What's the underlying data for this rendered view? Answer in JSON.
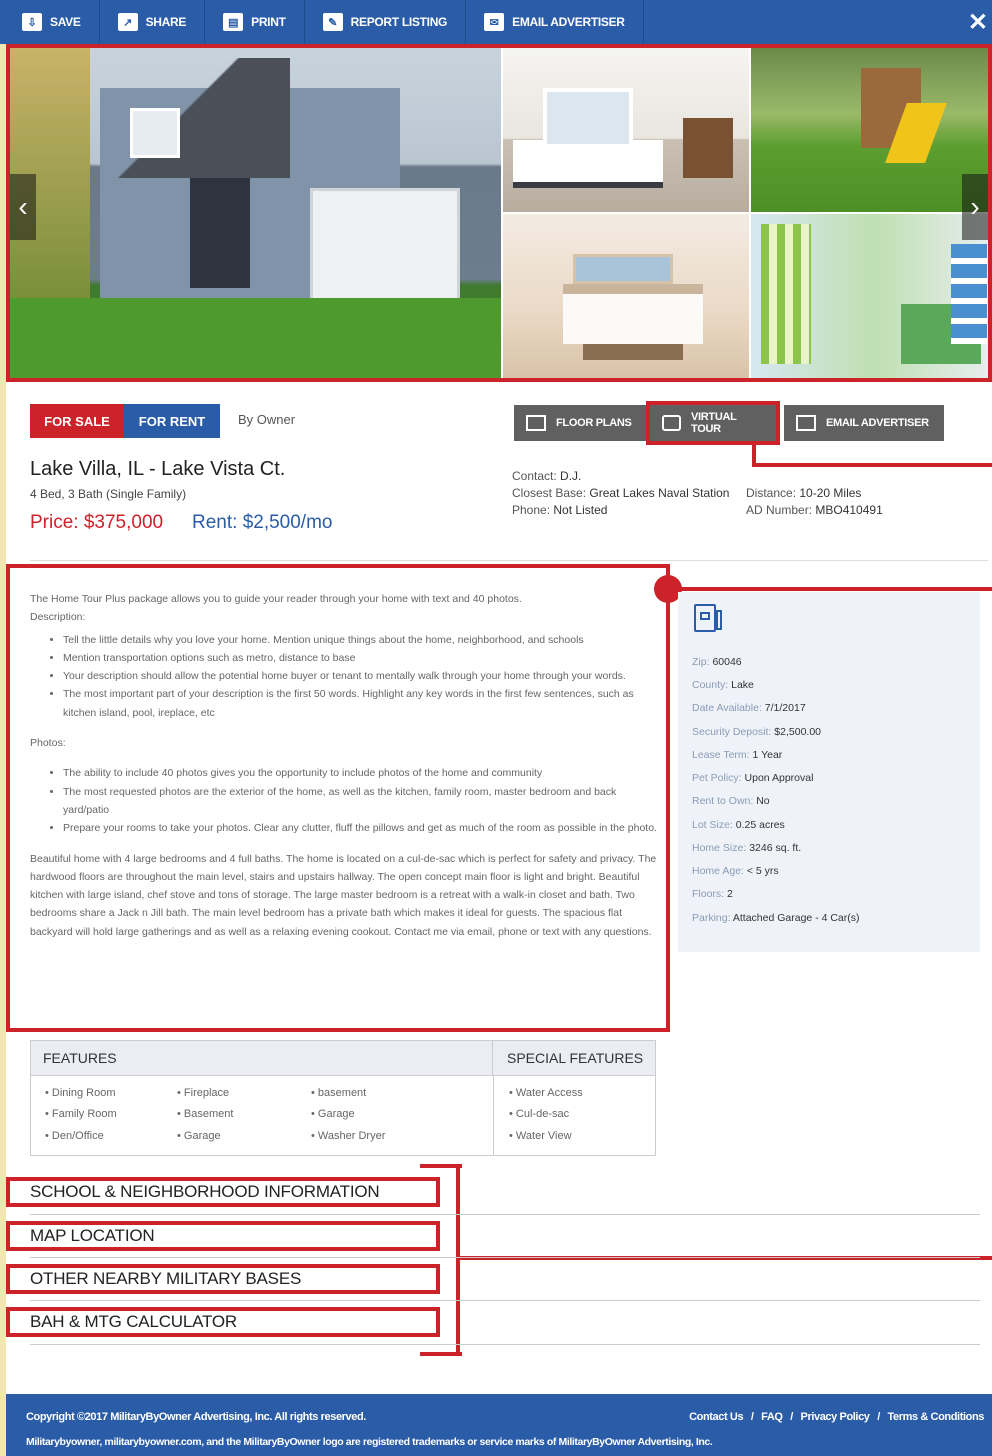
{
  "toolbar": {
    "items": [
      {
        "label": "SAVE",
        "icon": "download-icon"
      },
      {
        "label": "SHARE",
        "icon": "share-icon"
      },
      {
        "label": "PRINT",
        "icon": "print-icon"
      },
      {
        "label": "REPORT LISTING",
        "icon": "report-icon"
      },
      {
        "label": "EMAIL ADVERTISER",
        "icon": "megaphone-icon"
      }
    ],
    "close": "✕"
  },
  "gallery": {
    "prev": "‹",
    "next": "›"
  },
  "listing": {
    "for_sale": "FOR SALE",
    "for_rent": "FOR RENT",
    "by_owner": "By Owner",
    "title": "Lake Villa, IL - Lake Vista Ct.",
    "subtitle": "4 Bed, 3 Bath (Single Family)",
    "price": "Price: $375,000",
    "rent": "Rent: $2,500/mo",
    "buttons": {
      "floor_plans": "FLOOR PLANS",
      "virtual_tour": "VIRTUAL TOUR",
      "email_advertiser": "EMAIL ADVERTISER"
    },
    "contact_label": "Contact:",
    "contact_value": "D.J.",
    "base_label": "Closest Base:",
    "base_value": "Great Lakes Naval Station",
    "distance_label": "Distance:",
    "distance_value": "10-20 Miles",
    "phone_label": "Phone:",
    "phone_value": "Not Listed",
    "ad_label": "AD Number:",
    "ad_value": "MBO410491"
  },
  "description": {
    "intro": "The Home Tour Plus package allows you to guide your reader through your home with text and 40 photos.",
    "desc_label": "Description:",
    "desc_items": [
      "Tell the little details why you love your home. Mention unique things about the home, neighborhood, and schools",
      "Mention transportation options such as metro, distance to base",
      "Your description should allow the potential home buyer or tenant to mentally walk through your home through your words.",
      "The most important part of your description is the first 50 words. Highlight any key words in the first few sentences, such as kitchen island, pool, ireplace, etc"
    ],
    "photos_label": "Photos:",
    "photo_items": [
      "The ability to include 40 photos gives you the opportunity to include photos of the home and community",
      "The most requested photos are the exterior of the home, as well as the kitchen, family room, master bedroom and back yard/patio",
      "Prepare your rooms to take your photos. Clear any clutter, fluff the pillows and get as much of the room as possible in the photo."
    ],
    "body": "Beautiful home with 4 large bedrooms and 4 full baths. The home is located on a cul-de-sac which is perfect for safety and privacy. The hardwood floors are throughout the main level, stairs and upstairs hallway. The open concept main floor is light and bright. Beautiful kitchen with large island, chef stove and tons of storage. The large master bedroom is a retreat with a walk-in closet and bath. Two bedrooms share a Jack n Jill bath. The main level bedroom has a private bath which makes it ideal for guests. The spacious flat backyard will hold large gatherings and as well as a relaxing evening cookout. Contact me via email, phone or text with any questions."
  },
  "info": {
    "rows": [
      {
        "label": "Zip:",
        "value": "60046"
      },
      {
        "label": "County:",
        "value": "Lake"
      },
      {
        "label": "Date Available:",
        "value": "7/1/2017"
      },
      {
        "label": "Security Deposit:",
        "value": "$2,500.00"
      },
      {
        "label": "Lease Term:",
        "value": "1 Year"
      },
      {
        "label": "Pet Policy:",
        "value": "Upon Approval"
      },
      {
        "label": "Rent to Own:",
        "value": "No"
      },
      {
        "label": "Lot Size:",
        "value": "0.25 acres"
      },
      {
        "label": "Home Size:",
        "value": "3246 sq. ft."
      },
      {
        "label": "Home Age:",
        "value": "< 5 yrs"
      },
      {
        "label": "Floors:",
        "value": "2"
      },
      {
        "label": "Parking:",
        "value": "Attached Garage - 4 Car(s)"
      }
    ]
  },
  "features": {
    "header": "FEATURES",
    "special_header": "SPECIAL FEATURES",
    "col1": [
      "Dining Room",
      "Family Room",
      "Den/Office"
    ],
    "col2": [
      "Fireplace",
      "Basement",
      "Garage"
    ],
    "col3": [
      "basement",
      "Garage",
      "Washer Dryer"
    ],
    "special": [
      "Water Access",
      "Cul-de-sac",
      "Water View"
    ]
  },
  "sections": [
    "SCHOOL & NEIGHBORHOOD INFORMATION",
    "MAP LOCATION",
    "OTHER NEARBY MILITARY BASES",
    "BAH & MTG CALCULATOR"
  ],
  "footer": {
    "copyright": "Copyright ©2017 MilitaryByOwner Advertising, Inc. All rights reserved.",
    "trademark": "Militarybyowner, militarybyowner.com, and the MilitaryByOwner logo are registered trademarks or service marks of MilitaryByOwner Advertising, Inc.",
    "links": [
      "Contact Us",
      "FAQ",
      "Privacy Policy",
      "Terms & Conditions"
    ],
    "sep": "/"
  },
  "colors": {
    "brand_blue": "#2a5ca8",
    "annotation_red": "#cc2229",
    "button_gray": "#606060"
  }
}
